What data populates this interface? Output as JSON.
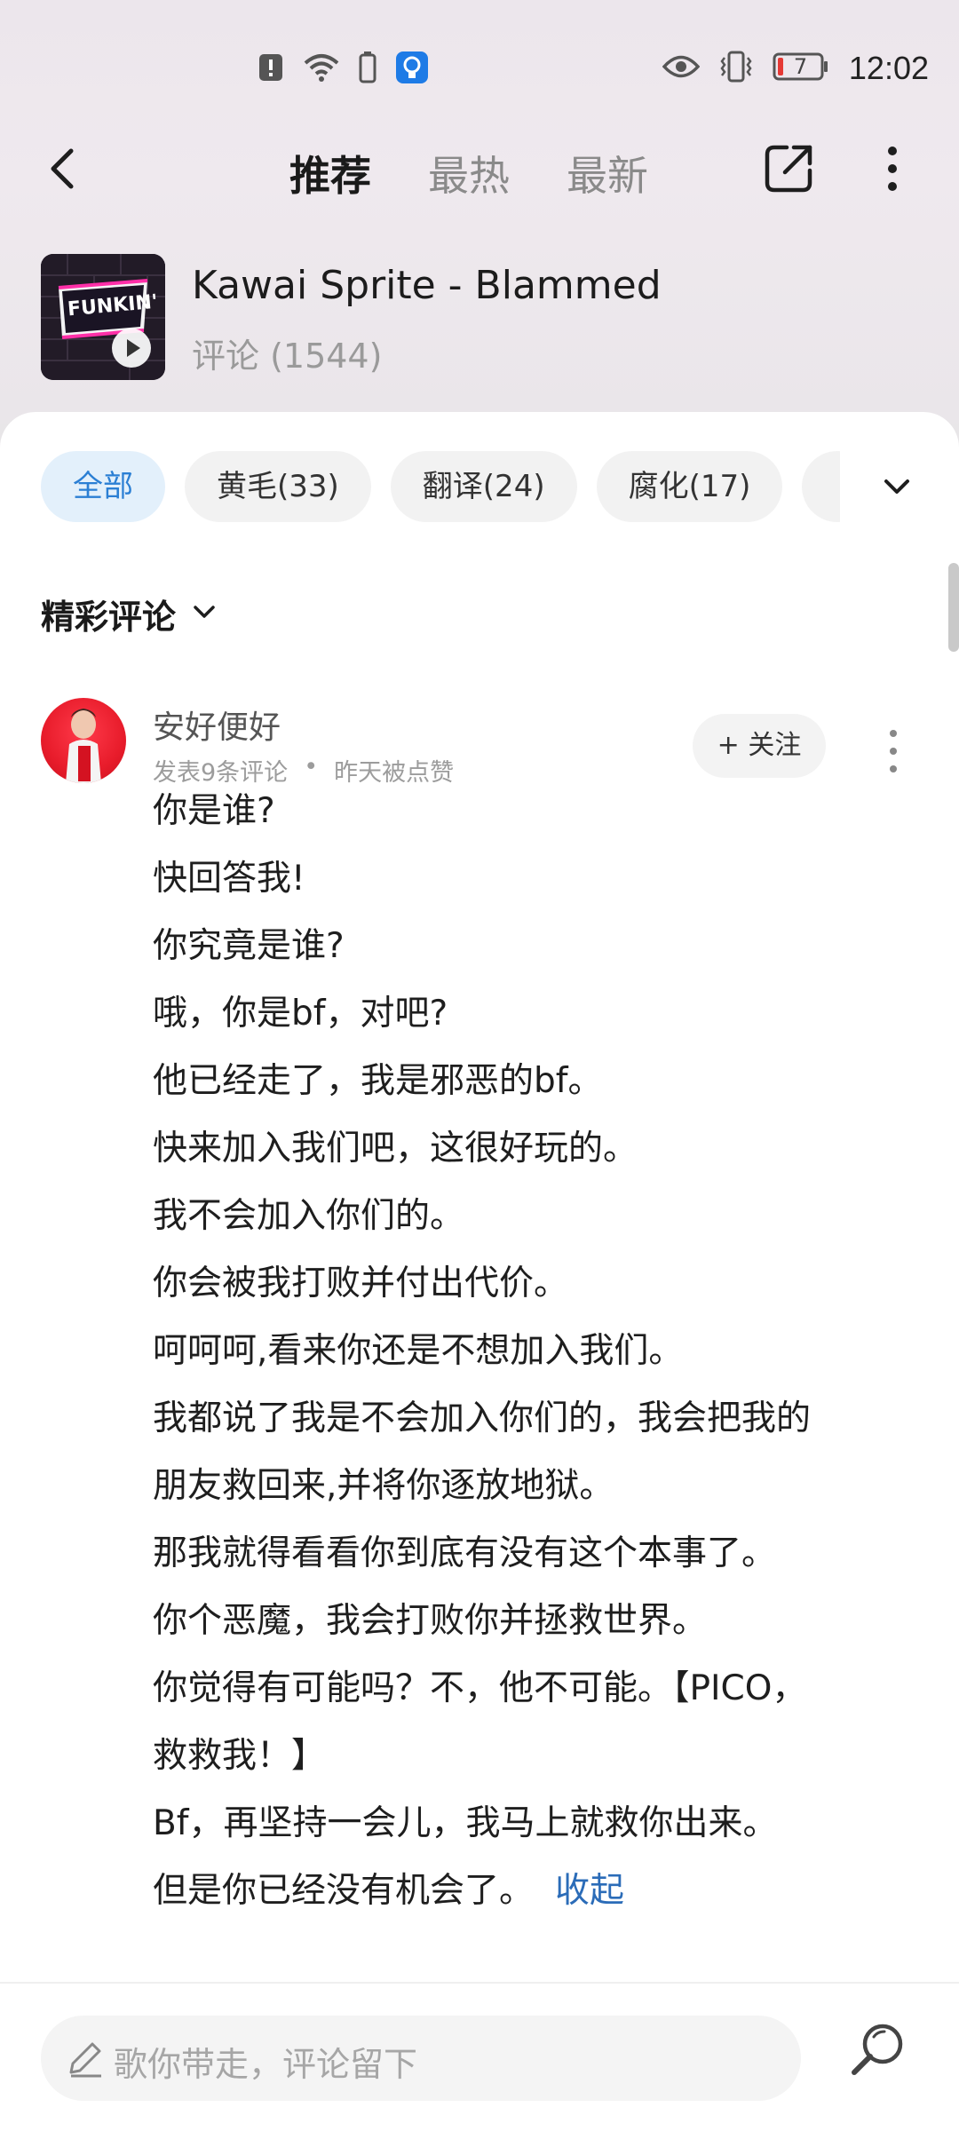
{
  "status_bar": {
    "time": "12:02",
    "battery_level": "7",
    "icons": [
      "alert-icon",
      "wifi-icon",
      "battery-small-icon",
      "bulb-icon",
      "eye-icon",
      "vibrate-icon",
      "battery-icon"
    ]
  },
  "header": {
    "tabs": [
      {
        "label": "推荐",
        "active": true
      },
      {
        "label": "最热",
        "active": false
      },
      {
        "label": "最新",
        "active": false
      }
    ]
  },
  "song": {
    "title": "Kawai Sprite - Blammed",
    "comment_count_label": "评论 (1544)",
    "cover_text": "FUNKIN'"
  },
  "filters": {
    "chips": [
      {
        "label": "全部",
        "active": true
      },
      {
        "label": "黄毛(33)",
        "active": false
      },
      {
        "label": "翻译(24)",
        "active": false
      },
      {
        "label": "腐化(17)",
        "active": false
      },
      {
        "label": "",
        "active": false
      }
    ]
  },
  "section": {
    "title": "精彩评论"
  },
  "comment": {
    "username": "安好便好",
    "meta_count": "发表9条评论",
    "meta_separator": "•",
    "meta_time": "昨天被点赞",
    "follow_label": "+ 关注",
    "lines": [
      "你是谁?",
      "快回答我!",
      "你究竟是谁?",
      "哦，你是bf，对吧?",
      "他已经走了，我是邪恶的bf。",
      "快来加入我们吧，这很好玩的。",
      "我不会加入你们的。",
      "你会被我打败并付出代价。",
      "呵呵呵,看来你还是不想加入我们。",
      "我都说了我是不会加入你们的，我会把我的",
      "朋友救回来,并将你逐放地狱。",
      "那我就得看看你到底有没有这个本事了。",
      "你个恶魔，我会打败你并拯救世界。",
      "你觉得有可能吗？不，他不可能。【PICO，",
      "救救我！】",
      "Bf，再坚持一会儿，我马上就救你出来。",
      "但是你已经没有机会了。"
    ],
    "collapse_label": "收起"
  },
  "input": {
    "placeholder": "歌你带走，评论留下"
  },
  "colors": {
    "accent": "#2b7fd4",
    "link": "#2b6cb8",
    "chip_active_bg": "#e3f0fb"
  }
}
